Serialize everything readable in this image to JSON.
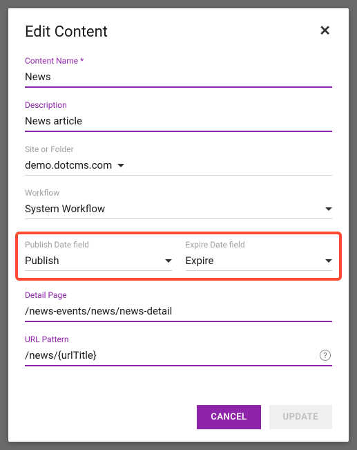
{
  "dialog": {
    "title": "Edit Content",
    "close_glyph": "✕"
  },
  "fields": {
    "content_name": {
      "label": "Content Name *",
      "value": "News"
    },
    "description": {
      "label": "Description",
      "value": "News article"
    },
    "site_or_folder": {
      "label": "Site or Folder",
      "value": "demo.dotcms.com"
    },
    "workflow": {
      "label": "Workflow",
      "value": "System Workflow"
    },
    "publish_date": {
      "label": "Publish Date field",
      "value": "Publish"
    },
    "expire_date": {
      "label": "Expire Date field",
      "value": "Expire"
    },
    "detail_page": {
      "label": "Detail Page",
      "value": "/news-events/news/news-detail"
    },
    "url_pattern": {
      "label": "URL Pattern",
      "value": "/news/{urlTitle}"
    }
  },
  "buttons": {
    "cancel": "CANCEL",
    "update": "UPDATE"
  },
  "help_glyph": "?"
}
